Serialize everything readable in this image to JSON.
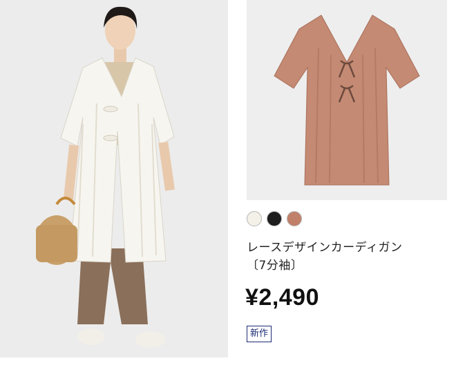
{
  "product": {
    "name_line1": "レースデザインカーディガン",
    "name_line2": "〔7分袖〕",
    "price": "¥2,490",
    "badge": "新作",
    "swatches": [
      {
        "name": "off-white",
        "color": "#f4f1e8"
      },
      {
        "name": "black",
        "color": "#1e1e1e"
      },
      {
        "name": "brown",
        "color": "#c0806a"
      }
    ]
  },
  "colors": {
    "lace_brown": "#c48a73",
    "lace_white": "#f7f5ef",
    "badge_navy": "#1b2a73"
  }
}
